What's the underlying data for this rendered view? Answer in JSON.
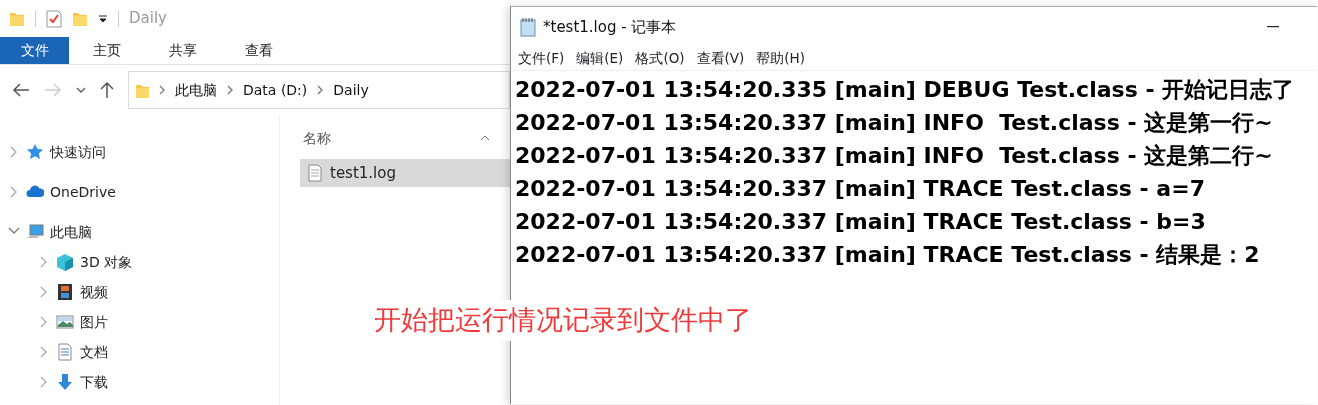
{
  "explorer": {
    "title": "Daily",
    "ribbon_tabs": [
      {
        "label": "文件",
        "selected": true
      },
      {
        "label": "主页",
        "selected": false
      },
      {
        "label": "共享",
        "selected": false
      },
      {
        "label": "查看",
        "selected": false
      }
    ],
    "breadcrumb": [
      "此电脑",
      "Data (D:)",
      "Daily"
    ],
    "nav_tree": [
      {
        "label": "快速访问",
        "kind": "star",
        "expanded": false
      },
      {
        "label": "OneDrive",
        "kind": "cloud",
        "expanded": false
      },
      {
        "label": "此电脑",
        "kind": "computer",
        "expanded": true,
        "children": [
          {
            "label": "3D 对象",
            "kind": "cube",
            "expanded": false
          },
          {
            "label": "视频",
            "kind": "film",
            "expanded": false
          },
          {
            "label": "图片",
            "kind": "image",
            "expanded": false
          },
          {
            "label": "文档",
            "kind": "doc",
            "expanded": false
          },
          {
            "label": "下载",
            "kind": "download",
            "expanded": false
          }
        ]
      }
    ],
    "column_header": "名称",
    "files": [
      {
        "name": "test1.log",
        "selected": true
      }
    ]
  },
  "notepad": {
    "title": "*test1.log - 记事本",
    "menu": [
      "文件(F)",
      "编辑(E)",
      "格式(O)",
      "查看(V)",
      "帮助(H)"
    ],
    "lines": [
      "2022-07-01 13:54:20.335 [main] DEBUG Test.class - 开始记日志了",
      "2022-07-01 13:54:20.337 [main] INFO  Test.class - 这是第一行~",
      "2022-07-01 13:54:20.337 [main] INFO  Test.class - 这是第二行~",
      "2022-07-01 13:54:20.337 [main] TRACE Test.class - a=7",
      "2022-07-01 13:54:20.337 [main] TRACE Test.class - b=3",
      "2022-07-01 13:54:20.337 [main] TRACE Test.class - 结果是：2"
    ]
  },
  "annotation": "开始把运行情况记录到文件中了"
}
